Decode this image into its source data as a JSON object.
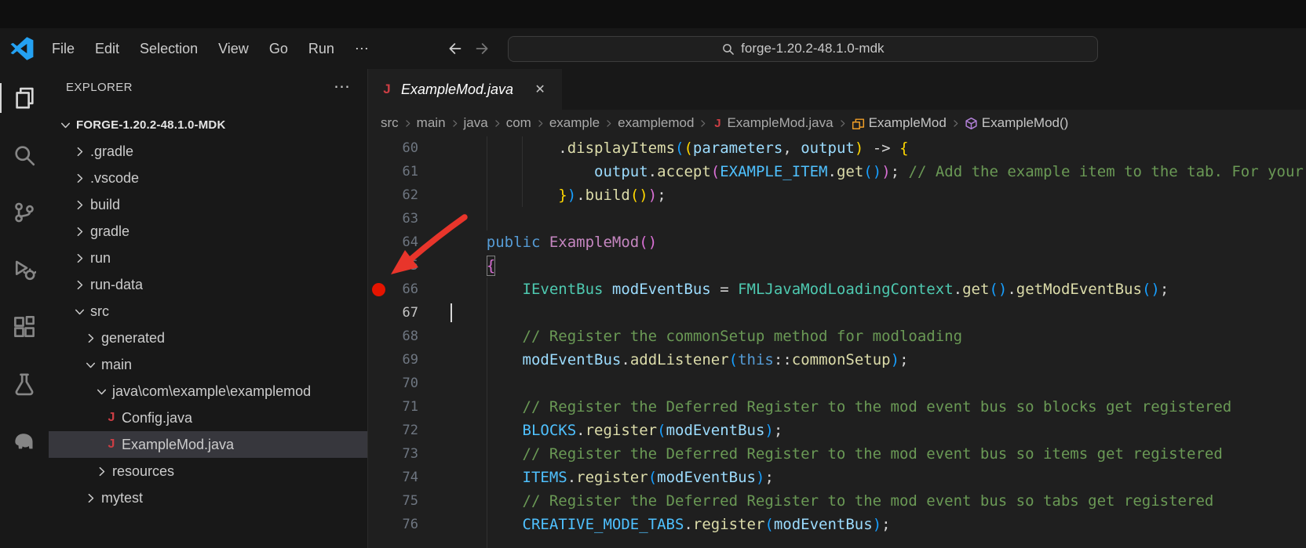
{
  "titlebar": {
    "menus": [
      "File",
      "Edit",
      "Selection",
      "View",
      "Go",
      "Run"
    ],
    "more_menu": "⋯",
    "command_center_text": "forge-1.20.2-48.1.0-mdk"
  },
  "activity_bar": {
    "items": [
      {
        "icon": "explorer-icon",
        "active": true
      },
      {
        "icon": "search-icon",
        "active": false
      },
      {
        "icon": "source-control-icon",
        "active": false
      },
      {
        "icon": "run-debug-icon",
        "active": false
      },
      {
        "icon": "extensions-icon",
        "active": false
      },
      {
        "icon": "testing-icon",
        "active": false
      },
      {
        "icon": "gradle-icon",
        "active": false
      }
    ]
  },
  "sidebar": {
    "title": "EXPLORER",
    "actions": "⋯",
    "tree": [
      {
        "label": "FORGE-1.20.2-48.1.0-MDK",
        "level": 0,
        "chevron": "down",
        "root": true
      },
      {
        "label": ".gradle",
        "level": 1,
        "chevron": "right"
      },
      {
        "label": ".vscode",
        "level": 1,
        "chevron": "right"
      },
      {
        "label": "build",
        "level": 1,
        "chevron": "right"
      },
      {
        "label": "gradle",
        "level": 1,
        "chevron": "right"
      },
      {
        "label": "run",
        "level": 1,
        "chevron": "right"
      },
      {
        "label": "run-data",
        "level": 1,
        "chevron": "right"
      },
      {
        "label": "src",
        "level": 1,
        "chevron": "down"
      },
      {
        "label": "generated",
        "level": 2,
        "chevron": "right"
      },
      {
        "label": "main",
        "level": 2,
        "chevron": "down"
      },
      {
        "label": "java\\com\\example\\examplemod",
        "level": 3,
        "chevron": "down"
      },
      {
        "label": "Config.java",
        "level": 4,
        "icon": "java"
      },
      {
        "label": "ExampleMod.java",
        "level": 4,
        "icon": "java",
        "selected": true
      },
      {
        "label": "resources",
        "level": 3,
        "chevron": "right"
      },
      {
        "label": "mytest",
        "level": 2,
        "chevron": "right"
      }
    ]
  },
  "editor": {
    "tab": {
      "icon": "java",
      "label": "ExampleMod.java",
      "close": "✕"
    },
    "breadcrumbs": [
      {
        "label": "src"
      },
      {
        "label": "main"
      },
      {
        "label": "java"
      },
      {
        "label": "com"
      },
      {
        "label": "example"
      },
      {
        "label": "examplemod"
      },
      {
        "label": "ExampleMod.java",
        "icon": "java"
      },
      {
        "label": "ExampleMod",
        "icon": "class"
      },
      {
        "label": "ExampleMod()",
        "icon": "method"
      }
    ],
    "lines": [
      {
        "num": 60,
        "tokens": [
          [
            "            ",
            "pl"
          ],
          [
            ".",
            "pl"
          ],
          [
            "displayItems",
            "fn"
          ],
          [
            "(",
            "b3"
          ],
          [
            "(",
            "b1"
          ],
          [
            "parameters",
            "vr"
          ],
          [
            ", ",
            "pl"
          ],
          [
            "output",
            "vr"
          ],
          [
            ")",
            "b1"
          ],
          [
            " -> ",
            "pl"
          ],
          [
            "{",
            "b1"
          ]
        ]
      },
      {
        "num": 61,
        "tokens": [
          [
            "                ",
            "pl"
          ],
          [
            "output",
            "vr"
          ],
          [
            ".",
            "pl"
          ],
          [
            "accept",
            "fn"
          ],
          [
            "(",
            "b2"
          ],
          [
            "EXAMPLE_ITEM",
            "ct"
          ],
          [
            ".",
            "pl"
          ],
          [
            "get",
            "fn"
          ],
          [
            "(",
            "b3"
          ],
          [
            ")",
            "b3"
          ],
          [
            ")",
            "b2"
          ],
          [
            "; ",
            "pl"
          ],
          [
            "// Add the example item to the tab. For your own tabs, this method is preferred over the event",
            "cm"
          ]
        ]
      },
      {
        "num": 62,
        "tokens": [
          [
            "            ",
            "pl"
          ],
          [
            "}",
            "b1"
          ],
          [
            ")",
            "b3"
          ],
          [
            ".",
            "pl"
          ],
          [
            "build",
            "fn"
          ],
          [
            "(",
            "b1"
          ],
          [
            ")",
            "b1"
          ],
          [
            ")",
            "b2"
          ],
          [
            ";",
            "pl"
          ]
        ]
      },
      {
        "num": 63,
        "tokens": []
      },
      {
        "num": 64,
        "tokens": [
          [
            "    ",
            "pl"
          ],
          [
            "public",
            "kw"
          ],
          [
            " ",
            "pl"
          ],
          [
            "ExampleMod",
            "pk"
          ],
          [
            "(",
            "b2"
          ],
          [
            ")",
            "b2"
          ]
        ]
      },
      {
        "num": 65,
        "tokens": [
          [
            "    ",
            "pl"
          ],
          [
            "{",
            "b2",
            "box"
          ]
        ]
      },
      {
        "num": 66,
        "breakpoint": true,
        "tokens": [
          [
            "        ",
            "pl"
          ],
          [
            "IEventBus",
            "ty"
          ],
          [
            " ",
            "pl"
          ],
          [
            "modEventBus",
            "vr"
          ],
          [
            " = ",
            "pl"
          ],
          [
            "FMLJavaModLoadingContext",
            "ty"
          ],
          [
            ".",
            "pl"
          ],
          [
            "get",
            "fn"
          ],
          [
            "(",
            "b3"
          ],
          [
            ")",
            "b3"
          ],
          [
            ".",
            "pl"
          ],
          [
            "getModEventBus",
            "fn"
          ],
          [
            "(",
            "b3"
          ],
          [
            ")",
            "b3"
          ],
          [
            ";",
            "pl"
          ]
        ]
      },
      {
        "num": 67,
        "cursor": true,
        "active": true,
        "tokens": []
      },
      {
        "num": 68,
        "tokens": [
          [
            "        ",
            "pl"
          ],
          [
            "// Register the commonSetup method for modloading",
            "cm"
          ]
        ]
      },
      {
        "num": 69,
        "tokens": [
          [
            "        ",
            "pl"
          ],
          [
            "modEventBus",
            "vr"
          ],
          [
            ".",
            "pl"
          ],
          [
            "addListener",
            "fn"
          ],
          [
            "(",
            "b3"
          ],
          [
            "this",
            "kw"
          ],
          [
            "::",
            "pl"
          ],
          [
            "commonSetup",
            "fn"
          ],
          [
            ")",
            "b3"
          ],
          [
            ";",
            "pl"
          ]
        ]
      },
      {
        "num": 70,
        "tokens": []
      },
      {
        "num": 71,
        "tokens": [
          [
            "        ",
            "pl"
          ],
          [
            "// Register the Deferred Register to the mod event bus so blocks get registered",
            "cm"
          ]
        ]
      },
      {
        "num": 72,
        "tokens": [
          [
            "        ",
            "pl"
          ],
          [
            "BLOCKS",
            "ct"
          ],
          [
            ".",
            "pl"
          ],
          [
            "register",
            "fn"
          ],
          [
            "(",
            "b3"
          ],
          [
            "modEventBus",
            "vr"
          ],
          [
            ")",
            "b3"
          ],
          [
            ";",
            "pl"
          ]
        ]
      },
      {
        "num": 73,
        "tokens": [
          [
            "        ",
            "pl"
          ],
          [
            "// Register the Deferred Register to the mod event bus so items get registered",
            "cm"
          ]
        ]
      },
      {
        "num": 74,
        "tokens": [
          [
            "        ",
            "pl"
          ],
          [
            "ITEMS",
            "ct"
          ],
          [
            ".",
            "pl"
          ],
          [
            "register",
            "fn"
          ],
          [
            "(",
            "b3"
          ],
          [
            "modEventBus",
            "vr"
          ],
          [
            ")",
            "b3"
          ],
          [
            ";",
            "pl"
          ]
        ]
      },
      {
        "num": 75,
        "tokens": [
          [
            "        ",
            "pl"
          ],
          [
            "// Register the Deferred Register to the mod event bus so tabs get registered",
            "cm"
          ]
        ]
      },
      {
        "num": 76,
        "tokens": [
          [
            "        ",
            "pl"
          ],
          [
            "CREATIVE_MODE_TABS",
            "ct"
          ],
          [
            ".",
            "pl"
          ],
          [
            "register",
            "fn"
          ],
          [
            "(",
            "b3"
          ],
          [
            "modEventBus",
            "vr"
          ],
          [
            ")",
            "b3"
          ],
          [
            ";",
            "pl"
          ]
        ]
      }
    ]
  },
  "colors": {
    "keyword": "#569cd6",
    "type": "#4ec9b0",
    "variable": "#9cdcfe",
    "constant": "#4fc1ff",
    "function": "#dcdcaa",
    "comment": "#6a9955",
    "plain": "#d4d4d4",
    "ctor": "#c586c0",
    "bracket1": "#ffd700",
    "bracket2": "#da70d6",
    "bracket3": "#179fff",
    "java_icon": "#cc3e44",
    "class_icon": "#ee9d28",
    "method_icon": "#b180d7",
    "breakpoint": "#e51400",
    "annotation_arrow": "#e8352b",
    "logo": "#24a1f2"
  }
}
